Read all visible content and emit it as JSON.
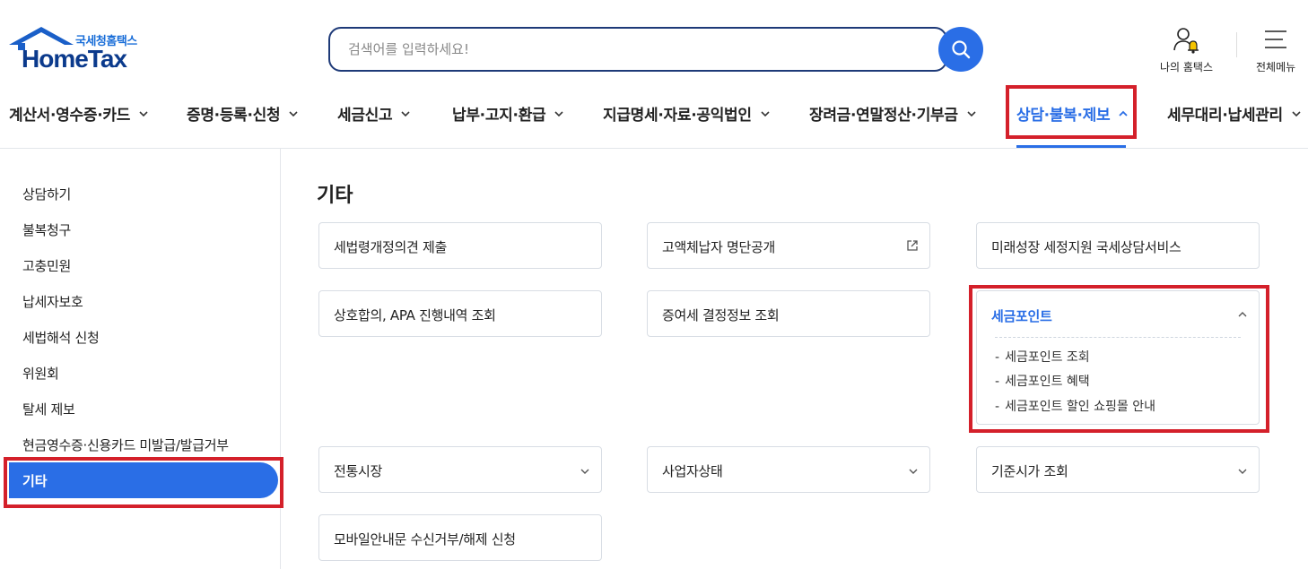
{
  "header": {
    "logo_korean": "국세청홈택스",
    "logo_english": "HomeTax",
    "search_placeholder": "검색어를 입력하세요!",
    "my_hometax_label": "나의 홈택스",
    "all_menu_label": "전체메뉴"
  },
  "nav": {
    "items": [
      {
        "label": "계산서·영수증·카드"
      },
      {
        "label": "증명·등록·신청"
      },
      {
        "label": "세금신고"
      },
      {
        "label": "납부·고지·환급"
      },
      {
        "label": "지급명세·자료·공익법인"
      },
      {
        "label": "장려금·연말정산·기부금"
      },
      {
        "label": "상담·불복·제보"
      },
      {
        "label": "세무대리·납세관리"
      }
    ],
    "active_index": 6
  },
  "sidebar": {
    "items": [
      {
        "label": "상담하기"
      },
      {
        "label": "불복청구"
      },
      {
        "label": "고충민원"
      },
      {
        "label": "납세자보호"
      },
      {
        "label": "세법해석 신청"
      },
      {
        "label": "위원회"
      },
      {
        "label": "탈세 제보"
      },
      {
        "label": "현금영수증·신용카드 미발급/발급거부"
      },
      {
        "label": "기타"
      }
    ],
    "active_index": 8
  },
  "main": {
    "title": "기타",
    "cards": [
      {
        "label": "세법령개정의견 제출"
      },
      {
        "label": "고액체납자 명단공개",
        "icon": "external-link-icon"
      },
      {
        "label": "미래성장 세정지원 국세상담서비스"
      },
      {
        "label": "상호합의, APA 진행내역 조회"
      },
      {
        "label": "증여세 결정정보 조회"
      },
      {
        "label": "세금포인트",
        "icon": "chevron-up-icon",
        "expanded": true,
        "sub_items": [
          {
            "label": "세금포인트 조회"
          },
          {
            "label": "세금포인트 혜택"
          },
          {
            "label": "세금포인트 할인 쇼핑몰 안내"
          }
        ]
      },
      {
        "label": "전통시장",
        "icon": "chevron-down-icon"
      },
      {
        "label": "사업자상태",
        "icon": "chevron-down-icon"
      },
      {
        "label": "기준시가 조회",
        "icon": "chevron-down-icon"
      },
      {
        "label": "모바일안내문 수신거부/해제 신청"
      }
    ],
    "sub_dash": "-"
  },
  "colors": {
    "accent": "#2a6ee6",
    "highlight_box": "#d4202a",
    "logo_dark": "#0b3a8c"
  }
}
